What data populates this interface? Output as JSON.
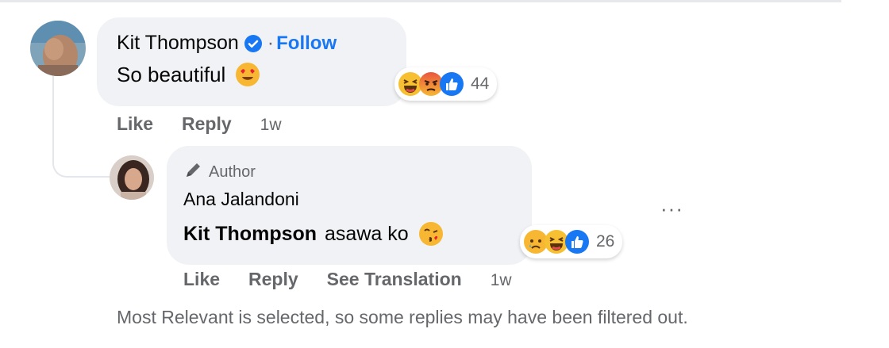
{
  "comment": {
    "author": "Kit Thompson",
    "follow_label": "Follow",
    "separator": "·",
    "text": "So beautiful",
    "reaction_count": "44",
    "actions": {
      "like": "Like",
      "reply": "Reply",
      "time": "1w"
    },
    "icons": [
      "heart-eyes-emoji-icon",
      "haha-reaction-icon",
      "angry-reaction-icon",
      "like-reaction-icon",
      "verified-badge-icon"
    ]
  },
  "reply": {
    "badge": "Author",
    "author": "Ana Jalandoni",
    "mention": "Kit Thompson",
    "text": "asawa ko",
    "reaction_count": "26",
    "more": "···",
    "actions": {
      "like": "Like",
      "reply": "Reply",
      "translate": "See Translation",
      "time": "1w"
    },
    "icons": [
      "kiss-emoji-icon",
      "sad-reaction-icon",
      "haha-reaction-icon",
      "like-reaction-icon",
      "pencil-icon"
    ]
  },
  "filter_note": "Most Relevant is selected, so some replies may have been filtered out.",
  "colors": {
    "link": "#1877f2",
    "bubble": "#f0f2f5",
    "secondary_text": "#65676b"
  }
}
